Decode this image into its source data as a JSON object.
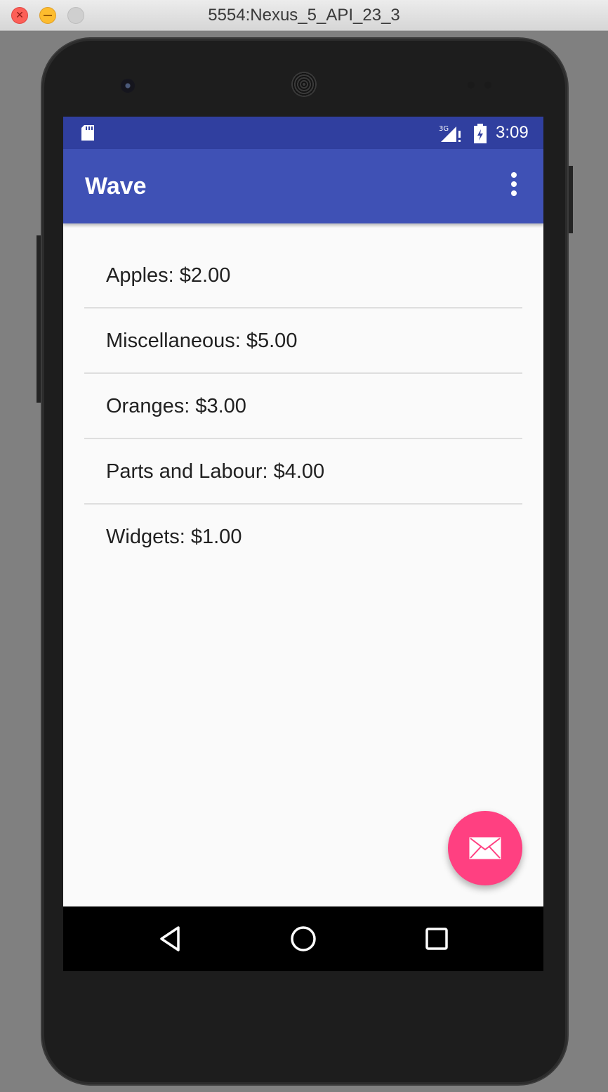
{
  "window": {
    "title": "5554:Nexus_5_API_23_3",
    "buttons": [
      "close",
      "minimize",
      "zoom"
    ]
  },
  "status_bar": {
    "time": "3:09",
    "network_label": "3G",
    "icons": [
      "sd-card-icon",
      "signal-3g-icon",
      "battery-icon"
    ],
    "color": "#303f9f"
  },
  "app_bar": {
    "title": "Wave",
    "menu_icon": "overflow-menu-icon",
    "color": "#3f51b5"
  },
  "list": {
    "items": [
      {
        "label": "Apples: $2.00"
      },
      {
        "label": "Miscellaneous: $5.00"
      },
      {
        "label": "Oranges: $3.00"
      },
      {
        "label": "Parts and Labour: $4.00"
      },
      {
        "label": "Widgets: $1.00"
      }
    ]
  },
  "fab": {
    "icon": "email-icon",
    "color": "#ff4081"
  },
  "nav_bar": {
    "buttons": [
      "back-icon",
      "home-icon",
      "recents-icon"
    ]
  }
}
